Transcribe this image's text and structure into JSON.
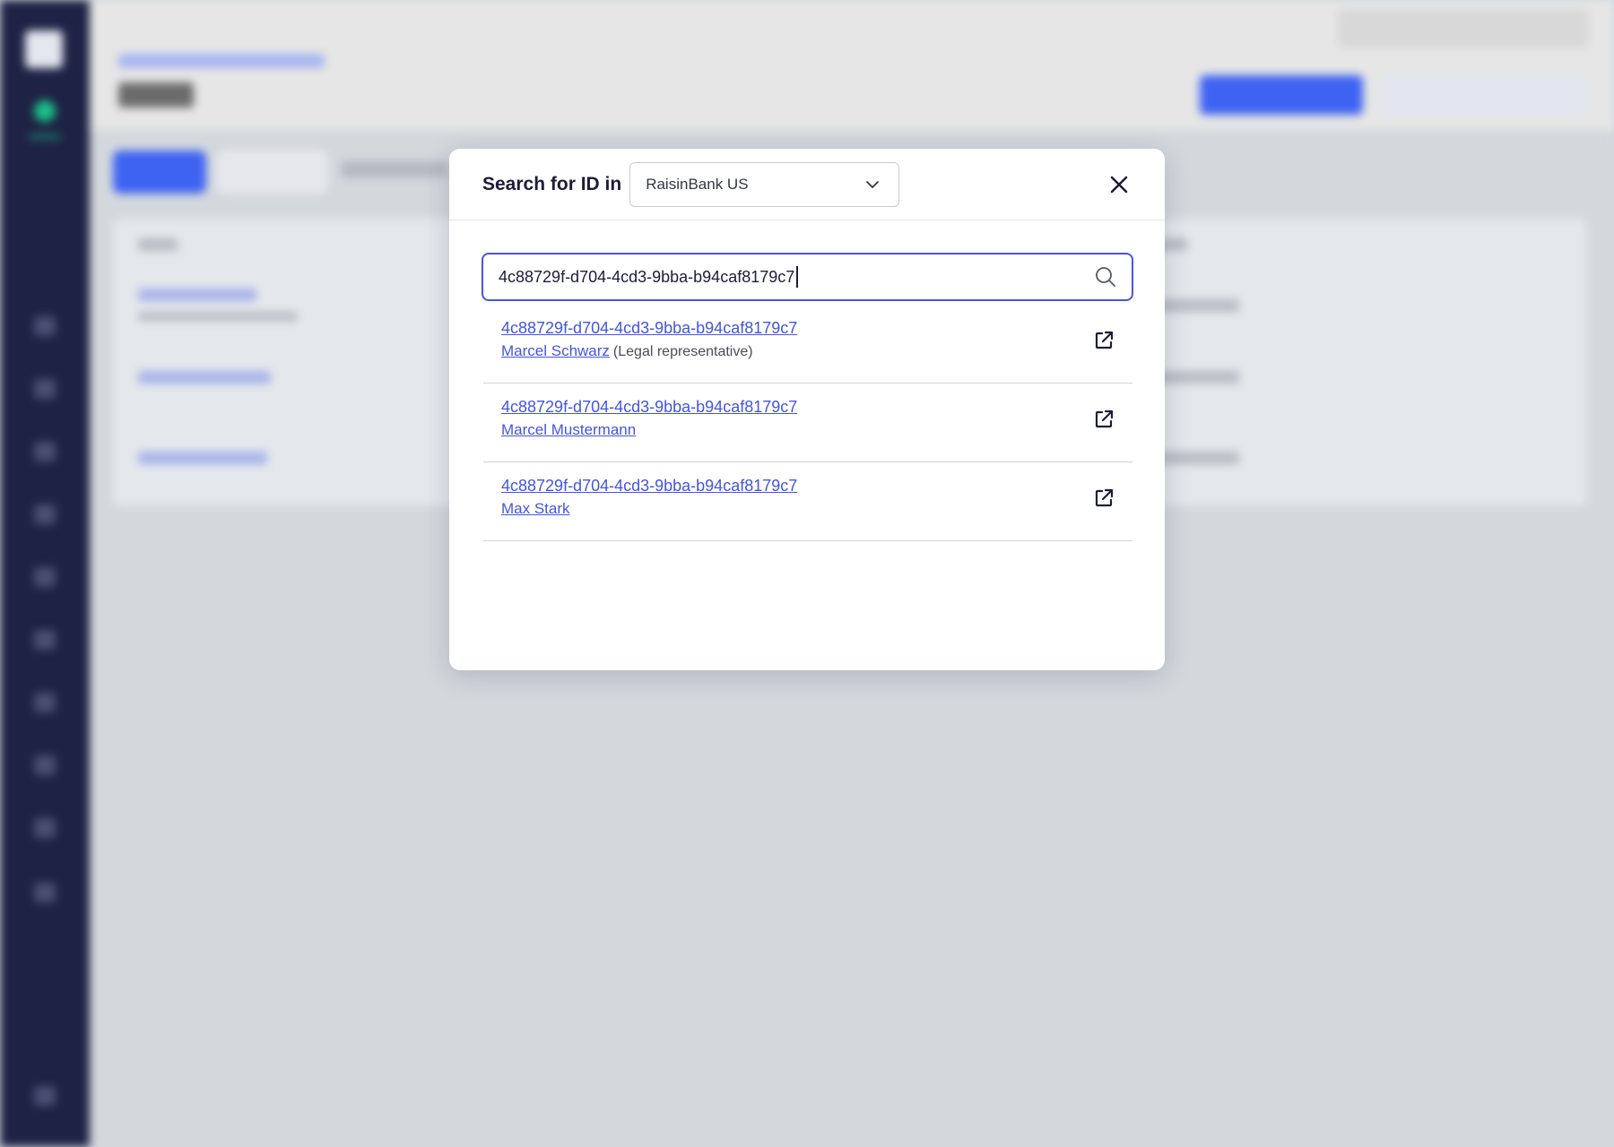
{
  "modal": {
    "title": "Search for ID in",
    "org_select": {
      "value": "RaisinBank US"
    },
    "close_icon": "close-icon",
    "search": {
      "value": "4c88729f-d704-4cd3-9bba-b94caf8179c7",
      "icon": "search-icon"
    },
    "results": [
      {
        "id": "4c88729f-d704-4cd3-9bba-b94caf8179c7",
        "name": "Marcel Schwarz",
        "role": "(Legal representative)",
        "icon": "external-link-icon"
      },
      {
        "id": "4c88729f-d704-4cd3-9bba-b94caf8179c7",
        "name": "Marcel Mustermann",
        "role": "",
        "icon": "external-link-icon"
      },
      {
        "id": "4c88729f-d704-4cd3-9bba-b94caf8179c7",
        "name": "Max Stark",
        "role": "",
        "icon": "external-link-icon"
      }
    ]
  },
  "background": {
    "page_title": "Users",
    "sidebar_icons": [
      "briefcase-icon",
      "chart-icon",
      "document-icon",
      "folder-icon",
      "gear-icon",
      "dollar-icon",
      "list-icon",
      "grid-icon",
      "trend-icon",
      "dots-icon",
      "settings-icon"
    ]
  },
  "colors": {
    "accent": "#4355e0",
    "sidebar": "#1e2244",
    "overlay": "#d3d8dd",
    "status_green": "#1dbf8a"
  }
}
